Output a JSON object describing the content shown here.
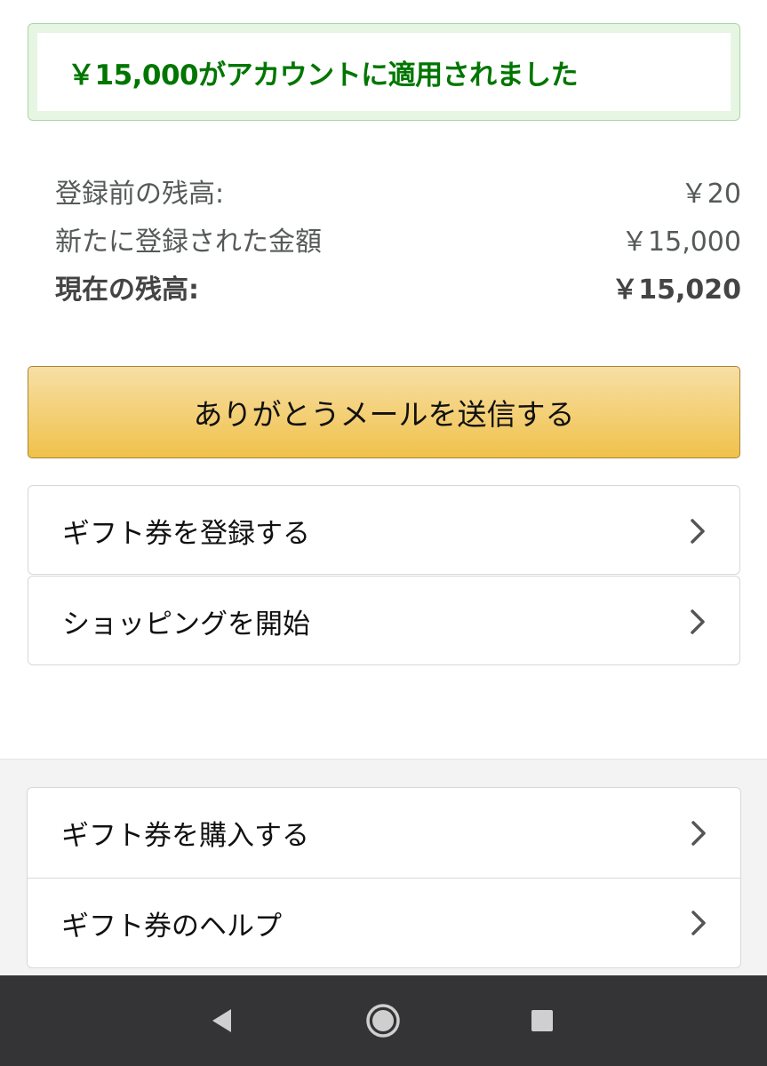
{
  "banner": {
    "message": "￥15,000がアカウントに適用されました",
    "color": "#007600"
  },
  "balances": [
    {
      "label": "登録前の残高:",
      "value": "￥20"
    },
    {
      "label": "新たに登録された金額",
      "value": "￥15,000"
    },
    {
      "label": "現在の残高:",
      "value": "￥15,020"
    }
  ],
  "actions": {
    "thanks_label": "ありがとうメールを送信する"
  },
  "menu_top": [
    {
      "label": "ギフト券を登録する",
      "icon": "chevron-right-icon"
    },
    {
      "label": "ショッピングを開始",
      "icon": "chevron-right-icon"
    }
  ],
  "menu_footer": [
    {
      "label": "ギフト券を購入する",
      "icon": "chevron-right-icon"
    },
    {
      "label": "ギフト券のヘルプ",
      "icon": "chevron-right-icon"
    }
  ],
  "system_nav": {
    "icons": [
      "back-icon",
      "home-icon",
      "recents-icon"
    ]
  }
}
